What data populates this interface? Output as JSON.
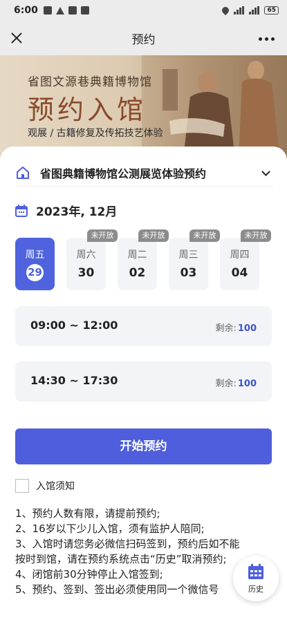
{
  "status_bar": {
    "time": "6:00",
    "battery": "65"
  },
  "nav": {
    "title": "预约"
  },
  "banner": {
    "subtitle": "省图文源巷典籍博物馆",
    "title": "预约入馆",
    "description": "观展 / 古籍修复及传拓技艺体验"
  },
  "museum": {
    "name": "省图典籍博物馆公测展览体验预约"
  },
  "calendar": {
    "month": "2023年, 12月",
    "days": [
      {
        "weekday": "周五",
        "date": "29",
        "selected": true,
        "badge": ""
      },
      {
        "weekday": "周六",
        "date": "30",
        "selected": false,
        "badge": "未开放"
      },
      {
        "weekday": "周二",
        "date": "02",
        "selected": false,
        "badge": "未开放"
      },
      {
        "weekday": "周三",
        "date": "03",
        "selected": false,
        "badge": "未开放"
      },
      {
        "weekday": "周四",
        "date": "04",
        "selected": false,
        "badge": "未开放"
      }
    ]
  },
  "slots": [
    {
      "time": "09:00 ~ 12:00",
      "remaining_label": "剩余:",
      "remaining": "100"
    },
    {
      "time": "14:30 ~ 17:30",
      "remaining_label": "剩余:",
      "remaining": "100"
    }
  ],
  "start_button": {
    "label": "开始预约"
  },
  "notice": {
    "label": "入馆须知",
    "checked": false
  },
  "rules": [
    "1、预约人数有限，请提前预约;",
    "2、16岁以下少儿入馆，须有监护人陪同;",
    "3、入馆时请您务必微信扫码签到，预约后如不能",
    "按时到馆，请在预约系统点击“历史”取消预约;",
    "4、闭馆前30分钟停止入馆签到;",
    "5、预约、签到、签出必须使用同一个微信号"
  ],
  "history_button": {
    "label": "历史"
  },
  "colors": {
    "primary": "#4e5edd",
    "badge": "#8c8c8c",
    "remaining": "#3d52c9"
  }
}
